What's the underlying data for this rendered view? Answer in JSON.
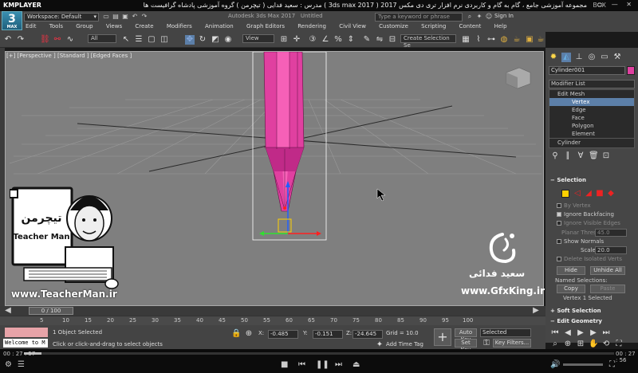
{
  "player": {
    "brand": "KMPLAYER",
    "title": "مجموعه آموزشی جامع ، گام به گام و کاربردی نرم افزار تری دی مکس 2017 ( 3ds max 2017 )   مدرس : سعید فدایی ( تیچرمن ) گروه آموزشی پادشاه گرافیست ها",
    "right_brand": "BOX",
    "window_controls": "▭ — ✕",
    "time_elapsed": "00 : 27 : 57",
    "time_total": "00 : 27 : 56",
    "progress_fraction": 0.03
  },
  "max": {
    "logo": "3",
    "logo_sub": "MAX",
    "workspace": "Workspace: Default",
    "app_title": "Autodesk 3ds Max 2017",
    "doc_title": "Untitled",
    "search_placeholder": "Type a keyword or phrase",
    "sign_in": "Sign In",
    "menu": [
      "Edit",
      "Tools",
      "Group",
      "Views",
      "Create",
      "Modifiers",
      "Animation",
      "Graph Editors",
      "Rendering",
      "Civil View",
      "Customize",
      "Scripting",
      "Content",
      "Help"
    ],
    "toolbar": {
      "filter": "All",
      "ref_coord": "View",
      "selection_set": "Create Selection Se"
    },
    "viewport": {
      "label": "[+] [Perspective ] [Standard ] [Edged Faces ]"
    }
  },
  "cmd": {
    "object_name": "Cylinder001",
    "modifier_list": "Modifier List",
    "stack": {
      "edit_mesh": "Edit Mesh",
      "vertex": "Vertex",
      "edge": "Edge",
      "face": "Face",
      "polygon": "Polygon",
      "element": "Element",
      "base": "Cylinder"
    },
    "selection": {
      "header": "Selection",
      "by_vertex": "By Vertex",
      "ignore_backfacing": "Ignore Backfacing",
      "ignore_visible_edges": "Ignore Visible Edges",
      "planar_thresh_label": "Planar Thresh:",
      "planar_thresh": "45.0",
      "show_normals": "Show Normals",
      "scale_label": "Scale:",
      "scale": "20.0",
      "delete_isolated": "Delete Isolated Verts",
      "hide": "Hide",
      "unhide_all": "Unhide All",
      "named_selections": "Named Selections:",
      "copy": "Copy",
      "paste": "Paste",
      "status": "Vertex 1 Selected"
    },
    "soft_selection": "Soft Selection",
    "edit_geometry": "Edit Geometry"
  },
  "timeline": {
    "slider": "0 / 100",
    "ticks": [
      "5",
      "10",
      "15",
      "20",
      "25",
      "30",
      "35",
      "40",
      "45",
      "50",
      "55",
      "60",
      "65",
      "70",
      "75",
      "80",
      "85",
      "90",
      "95",
      "100"
    ]
  },
  "status": {
    "listener": "Welcome to M",
    "line1": "1 Object Selected",
    "line2": "Click or click-and-drag to select objects",
    "x_label": "X:",
    "x": "-0.485",
    "y_label": "Y:",
    "y": "-0.151",
    "z_label": "Z:",
    "z": "-24.645",
    "grid": "Grid = 10.0",
    "add_time_tag": "Add Time Tag",
    "auto_key": "Auto Key",
    "set_key": "Set Key",
    "selected": "Selected",
    "key_filters": "Key Filters..."
  },
  "overlays": {
    "teacherman_url": "www.TeacherMan.ir",
    "teacherman_fa": "تیچرمن",
    "teacherman_en": "Teacher Man",
    "gfx_name": "سعید فدائی",
    "gfx_url": "www.GfxKing.ir"
  },
  "colors": {
    "pencil": "#e040a0",
    "selection_highlight": "#5c7fa8",
    "viewport_bg": "#7f7f7f"
  }
}
